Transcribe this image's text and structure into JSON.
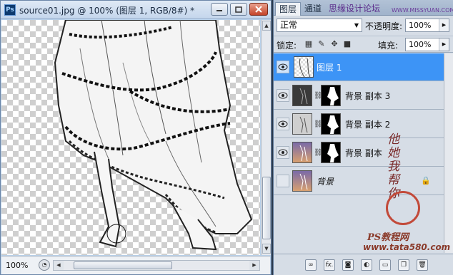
{
  "document": {
    "title": "source01.jpg @ 100% (图层 1, RGB/8#) *",
    "app_icon": "Ps",
    "zoom": "100%"
  },
  "layers_panel": {
    "tabs": [
      {
        "label": "图层",
        "active": true
      },
      {
        "label": "通道",
        "active": false
      },
      {
        "label": "思缘设计论坛",
        "active": false
      },
      {
        "label": "WWW.MISSYUAN.COM",
        "active": false
      }
    ],
    "blend_mode": "正常",
    "opacity_label": "不透明度:",
    "opacity_value": "100%",
    "lock_label": "锁定:",
    "fill_label": "填充:",
    "fill_value": "100%",
    "layers": [
      {
        "name": "图层 1",
        "visible": true,
        "selected": true,
        "has_mask": false,
        "locked": false
      },
      {
        "name": "背景 副本 3",
        "visible": true,
        "selected": false,
        "has_mask": true,
        "locked": false
      },
      {
        "name": "背景 副本 2",
        "visible": true,
        "selected": false,
        "has_mask": true,
        "locked": false
      },
      {
        "name": "背景 副本",
        "visible": true,
        "selected": false,
        "has_mask": true,
        "locked": false
      },
      {
        "name": "背景",
        "visible": false,
        "selected": false,
        "has_mask": false,
        "locked": true
      }
    ],
    "bottom_icons": [
      "link-icon",
      "fx-icon",
      "mask-icon",
      "adjustment-icon",
      "group-icon",
      "new-layer-icon",
      "trash-icon"
    ],
    "fx_label": "fx."
  },
  "watermark": {
    "line1": "他她我帮你",
    "site_name": "PS教程网",
    "url": "www.tata580.com"
  },
  "colors": {
    "selected_layer": "#3d94f6",
    "titlebar": "#c4d6ec"
  }
}
